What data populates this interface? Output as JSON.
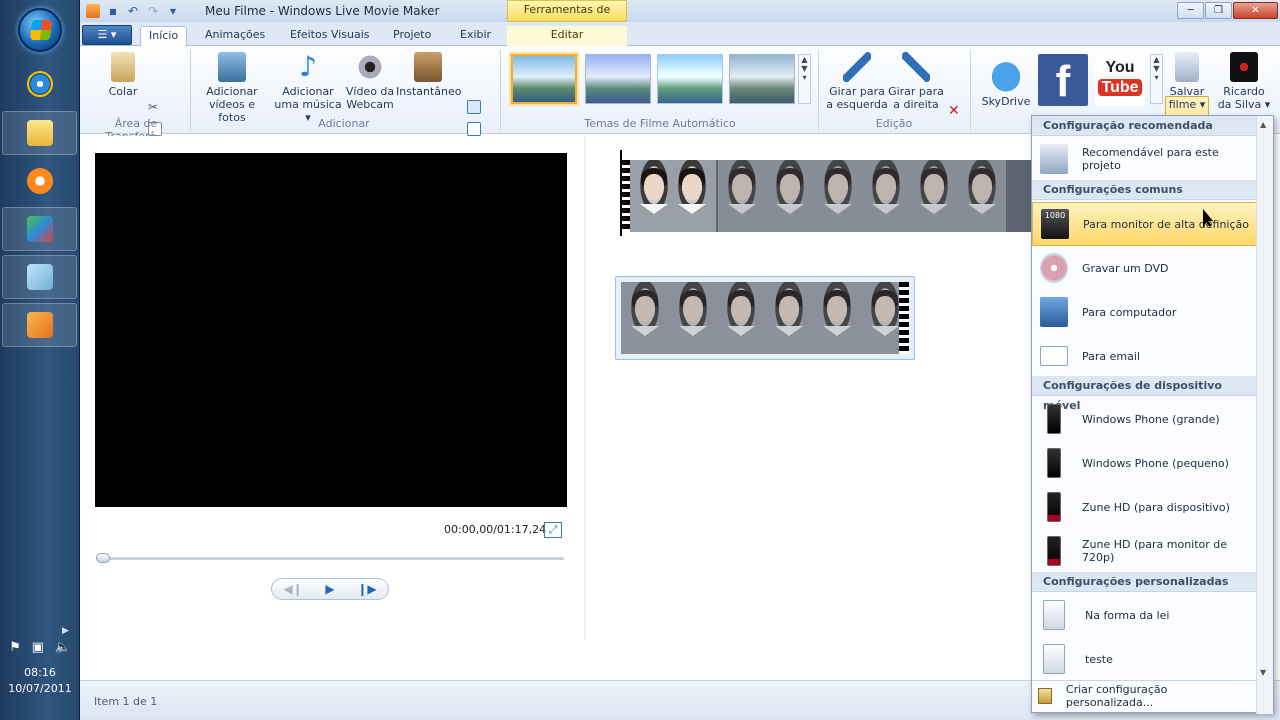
{
  "window": {
    "title": "Meu Filme - Windows Live Movie Maker",
    "context_tab_header": "Ferramentas de Vídeo"
  },
  "colors": {
    "accent": "#ffd767",
    "ribbon": "#e9f0fa",
    "title_bar": "#c9d9ee"
  },
  "tabs": [
    {
      "label": "Início",
      "active": true
    },
    {
      "label": "Animações"
    },
    {
      "label": "Efeitos Visuais"
    },
    {
      "label": "Projeto"
    },
    {
      "label": "Exibir"
    },
    {
      "label": "Editar",
      "context": true
    }
  ],
  "ribbon": {
    "clipboard": {
      "paste": "Colar",
      "group": "Área de Transferê..."
    },
    "add": {
      "add_videos": "Adicionar vídeos e fotos",
      "add_music": "Adicionar uma música ▾",
      "webcam": "Vídeo da Webcam",
      "snapshot": "Instantâneo",
      "group": "Adicionar"
    },
    "themes": {
      "group": "Temas de Filme Automático"
    },
    "editing": {
      "rotate_left": "Girar para a esquerda",
      "rotate_right": "Girar para a direita",
      "group": "Edição"
    },
    "share": {
      "skydrive": "SkyDrive",
      "save_movie": "Salvar filme ▾",
      "user": "Ricardo da Silva ▾"
    }
  },
  "preview": {
    "time": "00:00,00/01:17,24"
  },
  "status": {
    "item": "Item 1 de 1"
  },
  "taskbar": {
    "time": "08:16",
    "date": "10/07/2011"
  },
  "menu": {
    "sections": {
      "recommended": "Configuração recomendada",
      "common": "Configurações comuns",
      "mobile": "Configurações de dispositivo móvel",
      "custom": "Configurações personalizadas"
    },
    "items": {
      "recommended_project": "Recomendável para este projeto",
      "hd_monitor": "Para monitor de alta definição",
      "dvd": "Gravar um DVD",
      "computer": "Para computador",
      "email": "Para email",
      "wp_large": "Windows Phone (grande)",
      "wp_small": "Windows Phone (pequeno)",
      "zune_device": "Zune HD (para dispositivo)",
      "zune_720": "Zune HD (para monitor de 720p)",
      "custom_law": "Na forma da lei",
      "custom_test": "teste"
    },
    "footer": "Criar configuração personalizada...",
    "highlighted": "hd_monitor"
  }
}
